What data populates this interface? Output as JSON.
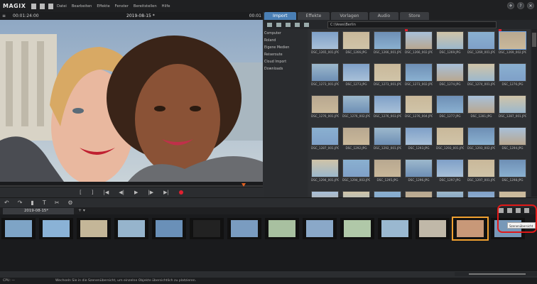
{
  "app": {
    "logo": "MAGIX",
    "menu": [
      "Datei",
      "Bearbeiten",
      "Effekte",
      "Fenster",
      "Bereitstellen",
      "Hilfe"
    ]
  },
  "preview": {
    "timecode_left": "00:01:24:00",
    "project_title": "2019-08-15 *",
    "timecode_right": "00:01"
  },
  "transport": {
    "buttons": [
      "[",
      "]",
      "|◀",
      "◀|",
      "▶",
      "|▶",
      "▶|"
    ]
  },
  "mediapool": {
    "tabs": [
      "Import",
      "Effekte",
      "Vorlagen",
      "Audio",
      "Store"
    ],
    "active_tab": "Import",
    "path": "C:\\Vews\\Berlin",
    "nav": [
      "Computer",
      "Roland",
      "Eigene Medien",
      "Reiseroute",
      "Cloud Import",
      "Downloads"
    ],
    "thumbnails": [
      [
        "DSC_1265_001.JPG",
        "DSC_1266.JPG",
        "DSC_1266_001.JPG",
        "DSC_1266_002.JPG",
        "DSC_1269.JPG",
        "DSC_1269_001.JPG",
        "DSC_1269_002.JPG"
      ],
      [
        "DSC_1273_001.JPG",
        "DSC_1273.JPG",
        "DSC_1273_001.JPG",
        "DSC_1273_002.JPG",
        "DSC_1274.JPG",
        "DSC_1274_001.JPG",
        "DSC_1276.JPG"
      ],
      [
        "DSC_1276_001.JPG",
        "DSC_1276_002.JPG",
        "DSC_1276_003.JPG",
        "DSC_1276_004.JPG",
        "DSC_1277.JPG",
        "DSC_1281.JPG",
        "DSC_1287_001.JPG"
      ],
      [
        "DSC_1287_001.JPG",
        "DSC_1292.JPG",
        "DSC_1292_001.JPG",
        "DSC_1293.JPG",
        "DSC_1293_001.JPG",
        "DSC_1293_002.JPG",
        "DSC_1294.JPG"
      ],
      [
        "DSC_1294_001.JPG",
        "DSC_1294_003.JPG",
        "DSC_1295.JPG",
        "DSC_1296.JPG",
        "DSC_1297.JPG",
        "DSC_1297_001.JPG",
        "DSC_1298.JPG"
      ],
      [
        "",
        "",
        "",
        "",
        "",
        "",
        ""
      ]
    ]
  },
  "timeline": {
    "tab_label": "2019-08-15*",
    "plus": "+ ▾",
    "tooltip": "Szenenübersicht"
  },
  "status": {
    "cpu": "CPU: —",
    "text": "Wechseln Sie in die Szenenübersicht, um einzelne Objekte übersichtlich zu platzieren."
  },
  "colors": {
    "accent": "#4a7fb5",
    "highlight": "#e01818",
    "selected": "#f0a030",
    "record": "#e02030"
  }
}
